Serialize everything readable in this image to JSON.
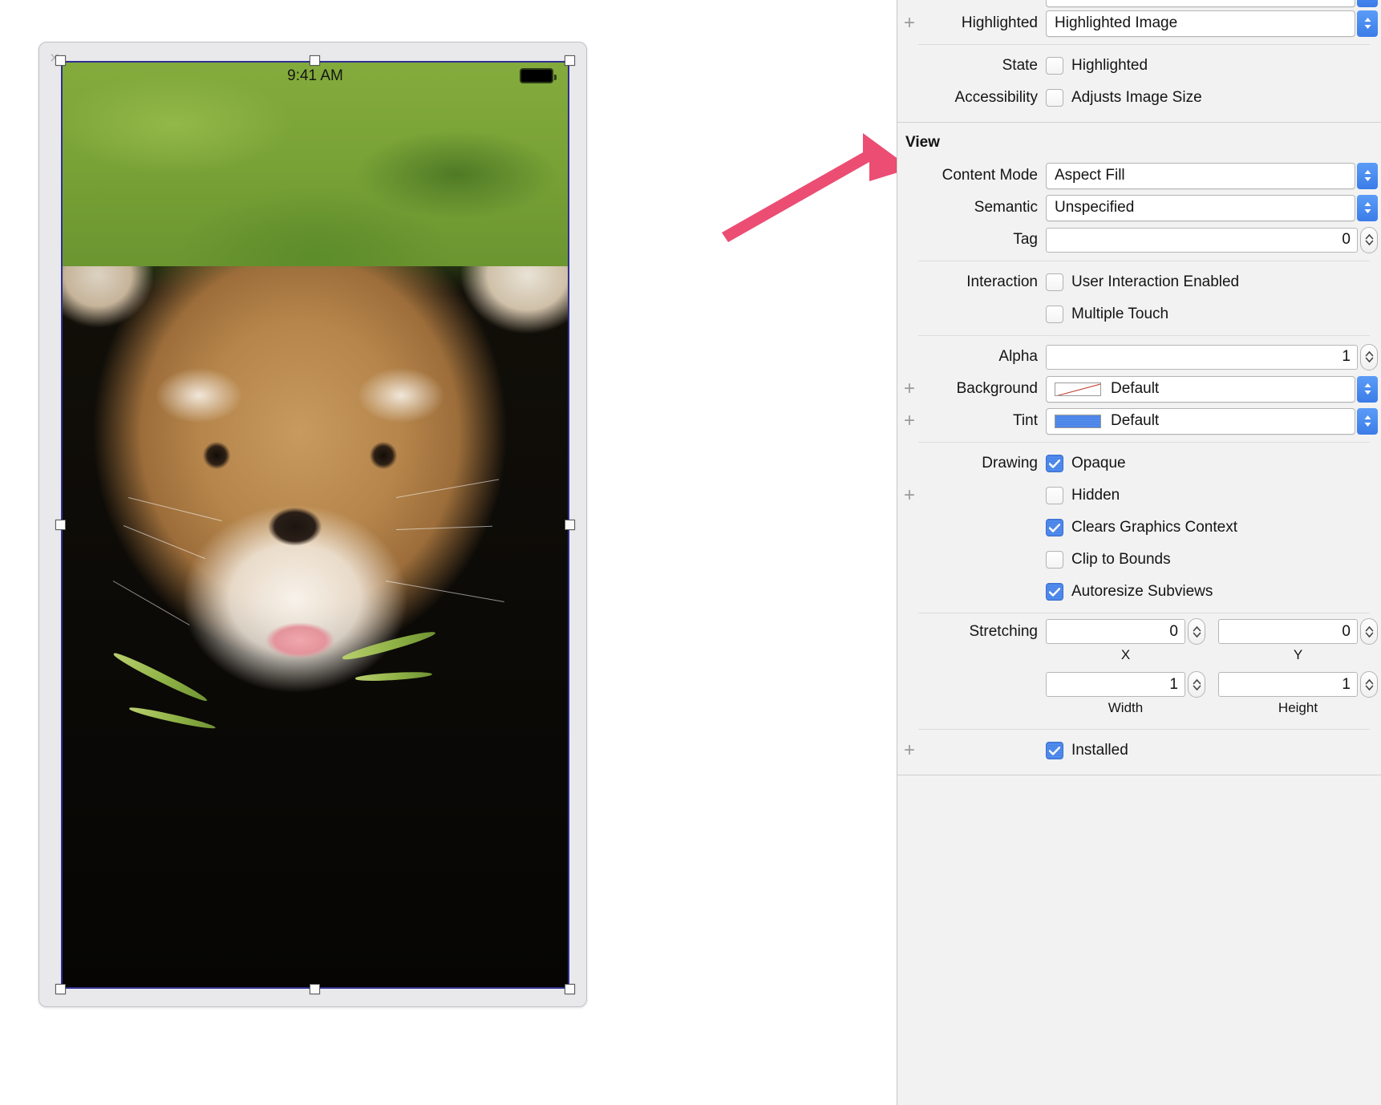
{
  "canvas": {
    "close_badge": "×",
    "device": {
      "status_time": "9:41 AM",
      "battery_icon": "battery-icon"
    }
  },
  "annotation": {
    "arrow_color": "#EC4D73",
    "points_at": "Content Mode"
  },
  "inspector": {
    "image_section": {
      "highlighted": {
        "label": "Highlighted",
        "placeholder": "Highlighted Image",
        "value": ""
      },
      "state": {
        "label": "State",
        "checkbox_label": "Highlighted",
        "checked": false
      },
      "accessibility": {
        "label": "Accessibility",
        "checkbox_label": "Adjusts Image Size",
        "checked": false
      }
    },
    "view_section": {
      "title": "View",
      "content_mode": {
        "label": "Content Mode",
        "value": "Aspect Fill"
      },
      "semantic": {
        "label": "Semantic",
        "value": "Unspecified"
      },
      "tag": {
        "label": "Tag",
        "value": "0"
      },
      "interaction": {
        "label": "Interaction",
        "user_interaction_enabled": {
          "label": "User Interaction Enabled",
          "checked": false
        },
        "multiple_touch": {
          "label": "Multiple Touch",
          "checked": false
        }
      },
      "alpha": {
        "label": "Alpha",
        "value": "1"
      },
      "background": {
        "label": "Background",
        "value": "Default",
        "swatch": "default-crossed-swatch"
      },
      "tint": {
        "label": "Tint",
        "value": "Default",
        "swatch": "blue-swatch",
        "color": "#4a84e8"
      },
      "drawing": {
        "label": "Drawing",
        "opaque": {
          "label": "Opaque",
          "checked": true
        },
        "hidden": {
          "label": "Hidden",
          "checked": false
        },
        "clears_graphics_context": {
          "label": "Clears Graphics Context",
          "checked": true
        },
        "clip_to_bounds": {
          "label": "Clip to Bounds",
          "checked": false
        },
        "autoresize_subviews": {
          "label": "Autoresize Subviews",
          "checked": true
        }
      },
      "stretching": {
        "label": "Stretching",
        "x": {
          "value": "0",
          "sub_label": "X"
        },
        "y": {
          "value": "0",
          "sub_label": "Y"
        },
        "width": {
          "value": "1",
          "sub_label": "Width"
        },
        "height": {
          "value": "1",
          "sub_label": "Height"
        }
      },
      "installed": {
        "label": "Installed",
        "checked": true
      }
    }
  }
}
